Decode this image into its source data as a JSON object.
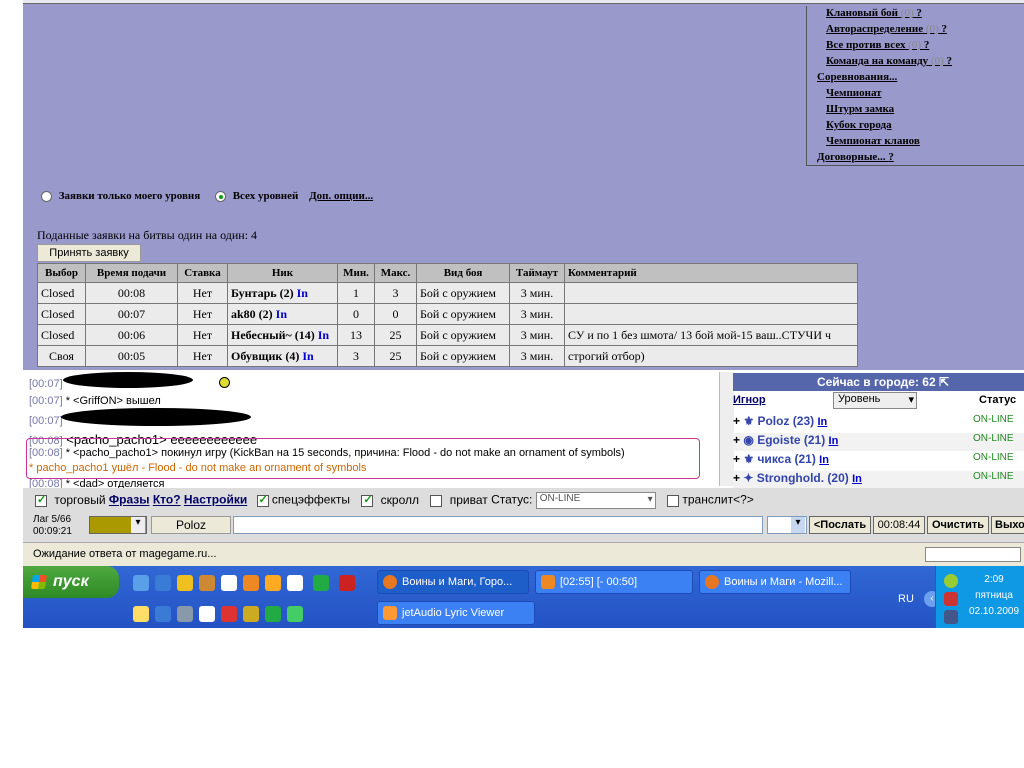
{
  "menu": {
    "items": [
      {
        "label": "Клановый бой",
        "count": "(0)",
        "help": "?"
      },
      {
        "label": "Автораспределение",
        "count": "(0)",
        "help": "?"
      },
      {
        "label": "Все против всех",
        "count": "(0)",
        "help": "?"
      },
      {
        "label": "Команда на команду",
        "count": "(0)",
        "help": "?"
      },
      {
        "label": "Соревнования...",
        "count": "",
        "help": ""
      },
      {
        "label": "Чемпионат",
        "count": "",
        "help": ""
      },
      {
        "label": "Штурм замка",
        "count": "",
        "help": ""
      },
      {
        "label": "Кубок города",
        "count": "",
        "help": ""
      },
      {
        "label": "Чемпионат кланов",
        "count": "",
        "help": ""
      },
      {
        "label": "Договорные...",
        "count": "",
        "help": "?"
      }
    ]
  },
  "filters": {
    "only_my_level": "Заявки только моего уровня",
    "all_levels": "Всех уровней",
    "more_options": "Доп. опции..."
  },
  "bids": {
    "title": "Поданные заявки на битвы один на один: 4",
    "accept_button": "Принять заявку",
    "headers": [
      "Выбор",
      "Время подачи",
      "Ставка",
      "Ник",
      "Мин.",
      "Макс.",
      "Вид боя",
      "Таймаут",
      "Комментарий"
    ],
    "rows": [
      {
        "choice": "Closed",
        "time": "00:08",
        "stake": "Нет",
        "nick": "Бунтарь (2)",
        "in": "In",
        "min": "1",
        "max": "3",
        "type": "Бой с оружием",
        "timeout": "3 мин.",
        "comment": ""
      },
      {
        "choice": "Closed",
        "time": "00:07",
        "stake": "Нет",
        "nick": "ak80 (2)",
        "in": "In",
        "min": "0",
        "max": "0",
        "type": "Бой с оружием",
        "timeout": "3 мин.",
        "comment": ""
      },
      {
        "choice": "Closed",
        "time": "00:06",
        "stake": "Нет",
        "nick": "Небесный~ (14)",
        "in": "In",
        "min": "13",
        "max": "25",
        "type": "Бой с оружием",
        "timeout": "3 мин.",
        "comment": "СУ и по 1 без шмота/ 13 бой мой-15 ваш..СТУЧИ ч"
      },
      {
        "choice": "Своя",
        "time": "00:05",
        "stake": "Нет",
        "nick": "Обувщик (4)",
        "in": "In",
        "min": "3",
        "max": "25",
        "type": "Бой с оружием",
        "timeout": "3 мин.",
        "comment": "строгий отбор)"
      }
    ]
  },
  "chat": {
    "lines": [
      {
        "ts": "[00:07]",
        "text": ""
      },
      {
        "ts": "[00:07]",
        "text": "* <GriffON> вышел"
      },
      {
        "ts": "[00:07]",
        "text": ""
      },
      {
        "ts": "[00:08]",
        "text": "<pacho_pacho1> ееееееееееее"
      },
      {
        "ts": "[00:08]",
        "text": "* <pacho_pacho1> покинул игру (KickBan на 15 seconds, причина: Flood - do not make an ornament of symbols)"
      },
      {
        "ts": "",
        "text": "* pacho_pacho1 ушёл - Flood - do not make an ornament of symbols"
      },
      {
        "ts": "[00:08]",
        "text": "* <dad> отделяется"
      }
    ]
  },
  "online": {
    "title": "Сейчас в городе: 62",
    "col_ignore": "Игнор",
    "col_level": "Уровень",
    "col_status": "Статус",
    "users": [
      {
        "name": "Poloz (23)",
        "in": "In",
        "status": "ON-LINE"
      },
      {
        "name": "Egoiste (21)",
        "in": "In",
        "status": "ON-LINE"
      },
      {
        "name": "чикса (21)",
        "in": "In",
        "status": "ON-LINE"
      },
      {
        "name": "Stronghold. (20)",
        "in": "In",
        "status": "ON-LINE"
      }
    ]
  },
  "controls": {
    "trade": "торговый",
    "phrases": "Фразы",
    "who": "Кто?",
    "settings": "Настройки",
    "effects": "спецэффекты",
    "scroll": "скролл",
    "private": "приват",
    "status_label": "Статус:",
    "status_value": "ON-LINE",
    "translit": "транслит<?>",
    "lag": "Лаг 5/66",
    "clock": "00:09:21",
    "nick": "Poloz",
    "send": "<Послать",
    "time": "00:08:44",
    "clear": "Очистить",
    "exit": "Выхо"
  },
  "status_bar": {
    "text": "Ожидание ответа от magegame.ru..."
  },
  "taskbar": {
    "start": "пуск",
    "tasks": [
      "Воины и Маги, Горо...",
      "[02:55] [- 00:50]",
      "Воины и Маги - Mozill...",
      "jetAudio Lyric Viewer"
    ],
    "lang": "RU",
    "time": "2:09",
    "day": "пятница",
    "date": "02.10.2009"
  },
  "colors": {
    "page_bg": "#9999cc",
    "link": "#0000cc",
    "taskbar": "#2452c4"
  }
}
